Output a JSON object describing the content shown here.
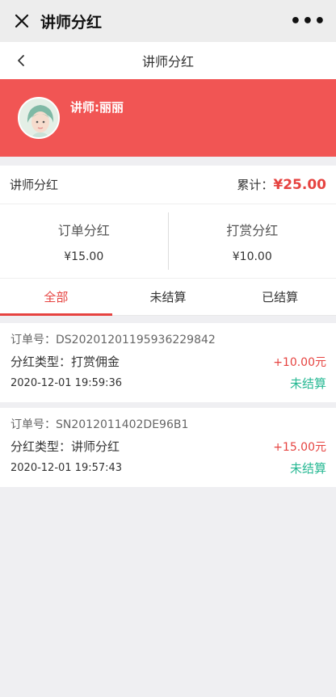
{
  "wechat_bar": {
    "title": "讲师分红",
    "more": "•••"
  },
  "nav": {
    "title": "讲师分红"
  },
  "profile": {
    "name": "讲师:丽丽"
  },
  "summary": {
    "label": "讲师分红",
    "total_label": "累计：",
    "total_value": "¥25.00"
  },
  "split": [
    {
      "label": "订单分红",
      "value": "¥15.00"
    },
    {
      "label": "打赏分红",
      "value": "¥10.00"
    }
  ],
  "tabs": [
    {
      "label": "全部",
      "active": true
    },
    {
      "label": "未结算",
      "active": false
    },
    {
      "label": "已结算",
      "active": false
    }
  ],
  "orders": [
    {
      "order_label": "订单号：",
      "order_no": "DS20201201195936229842",
      "type_label": "分红类型：",
      "type": "打赏佣金",
      "amount": "+10.00元",
      "date": "2020-12-01 19:59:36",
      "status": "未结算"
    },
    {
      "order_label": "订单号：",
      "order_no": "SN2012011402DE96B1",
      "type_label": "分红类型：",
      "type": "讲师分红",
      "amount": "+15.00元",
      "date": "2020-12-01 19:57:43",
      "status": "未结算"
    }
  ],
  "colors": {
    "accent": "#e64340",
    "banner": "#f15554",
    "status_pending": "#26b893"
  }
}
